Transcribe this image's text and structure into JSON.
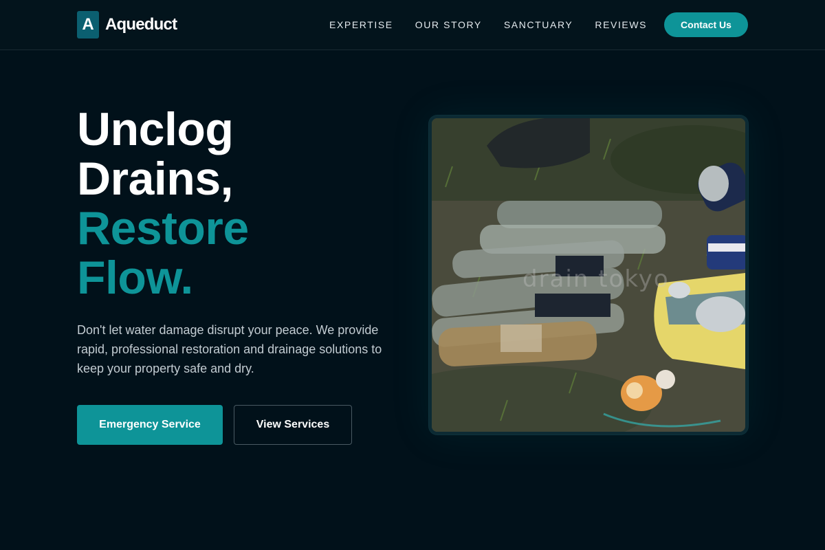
{
  "brand": {
    "logo_letter": "A",
    "name": "Aqueduct"
  },
  "nav": {
    "items": [
      "EXPERTISE",
      "OUR STORY",
      "SANCTUARY",
      "REVIEWS"
    ],
    "contact_label": "Contact Us"
  },
  "hero": {
    "headline_line1": "Unclog",
    "headline_line2": "Drains,",
    "headline_line3": "Restore",
    "headline_line4": "Flow.",
    "description": "Don't let water damage disrupt your peace. We provide rapid, professional restoration and drainage solutions to keep your property safe and dry.",
    "primary_button": "Emergency Service",
    "secondary_button": "View Services",
    "image_watermark": "drain tokyo"
  },
  "colors": {
    "background": "#01111a",
    "accent": "#0e9498",
    "text": "#ffffff",
    "muted_text": "#c3ccd2"
  },
  "icons": {
    "logo": "logo-mark-icon"
  }
}
